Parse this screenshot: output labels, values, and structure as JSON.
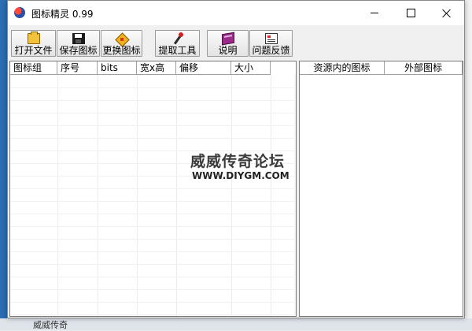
{
  "window": {
    "title": "图标精灵 0.99"
  },
  "toolbar": {
    "buttons": [
      {
        "label": "打开文件",
        "icon": "open-folder-icon"
      },
      {
        "label": "保存图标",
        "icon": "save-disk-icon"
      },
      {
        "label": "更换图标",
        "icon": "replace-icon"
      },
      {
        "label": "提取工具",
        "icon": "eyedropper-icon"
      },
      {
        "label": "说明",
        "icon": "help-book-icon"
      },
      {
        "label": "问题反馈",
        "icon": "feedback-card-icon"
      }
    ]
  },
  "icon_list": {
    "columns": [
      "图标组",
      "序号",
      "bits",
      "宽x高",
      "偏移",
      "大小"
    ]
  },
  "resource_panel": {
    "columns": [
      "资源内的图标",
      "外部图标"
    ]
  },
  "watermark": {
    "title": "威威传奇论坛",
    "url": "WWW.DIYGM.COM"
  },
  "background": {
    "bottom_text": "威威传奇"
  }
}
